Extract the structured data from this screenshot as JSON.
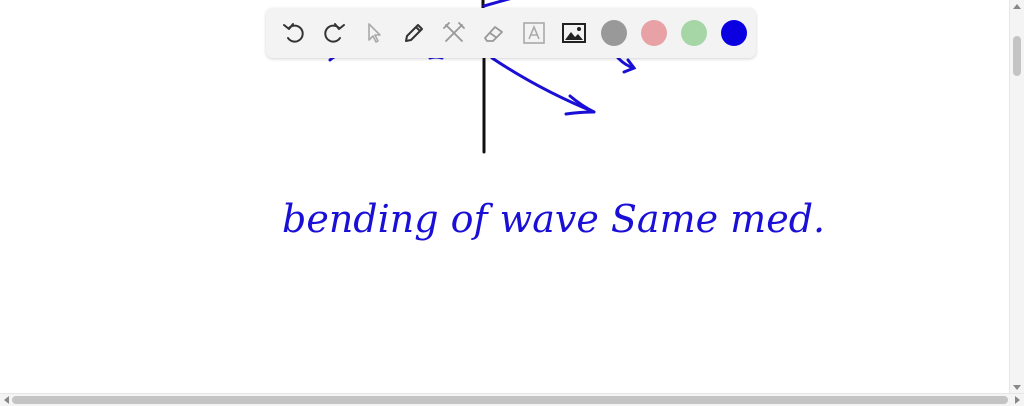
{
  "board": {
    "handwriting": "bending of wave Same med."
  },
  "toolbar": {
    "tools": [
      {
        "name": "undo",
        "icon": "undo-icon"
      },
      {
        "name": "redo",
        "icon": "redo-icon"
      },
      {
        "name": "select",
        "icon": "pointer-icon"
      },
      {
        "name": "pen",
        "icon": "pen-icon"
      },
      {
        "name": "tools",
        "icon": "hammer-wrench-icon"
      },
      {
        "name": "eraser",
        "icon": "eraser-icon"
      },
      {
        "name": "text",
        "icon": "text-box-icon"
      },
      {
        "name": "image",
        "icon": "image-icon"
      }
    ],
    "colors": [
      "#999999",
      "#e8a2a6",
      "#a6d6a6",
      "#0a00e0"
    ],
    "selected_color": "#0a00e0"
  }
}
